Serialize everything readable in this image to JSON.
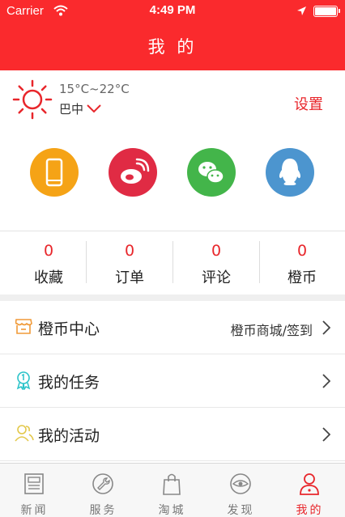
{
  "status_bar": {
    "carrier": "Carrier",
    "time": "4:49 PM"
  },
  "header": {
    "title": "我 的"
  },
  "weather": {
    "temperature": "15°C~22°C",
    "city": "巴中",
    "settings_label": "设置"
  },
  "socials": [
    {
      "icon": "phone-icon",
      "color": "#f5a316"
    },
    {
      "icon": "weibo-icon",
      "color": "#e02b44"
    },
    {
      "icon": "wechat-icon",
      "color": "#43b54a"
    },
    {
      "icon": "qq-icon",
      "color": "#4c95cf"
    }
  ],
  "stats": [
    {
      "count": "0",
      "label": "收藏"
    },
    {
      "count": "0",
      "label": "订单"
    },
    {
      "count": "0",
      "label": "评论"
    },
    {
      "count": "0",
      "label": "橙币"
    }
  ],
  "menu": [
    {
      "label": "橙币中心",
      "right_text": "橙币商城/签到",
      "icon": "shop-icon"
    },
    {
      "label": "我的任务",
      "right_text": "",
      "icon": "badge-icon"
    },
    {
      "label": "我的活动",
      "right_text": "",
      "icon": "users-icon"
    }
  ],
  "tabs": [
    {
      "label": "新闻",
      "icon": "news-icon"
    },
    {
      "label": "服务",
      "icon": "service-icon"
    },
    {
      "label": "淘城",
      "icon": "bag-icon"
    },
    {
      "label": "发现",
      "icon": "discover-icon"
    },
    {
      "label": "我的",
      "icon": "profile-icon",
      "active": true
    }
  ],
  "colors": {
    "brand_red": "#fa2a2d",
    "accent_red": "#e8262b"
  }
}
